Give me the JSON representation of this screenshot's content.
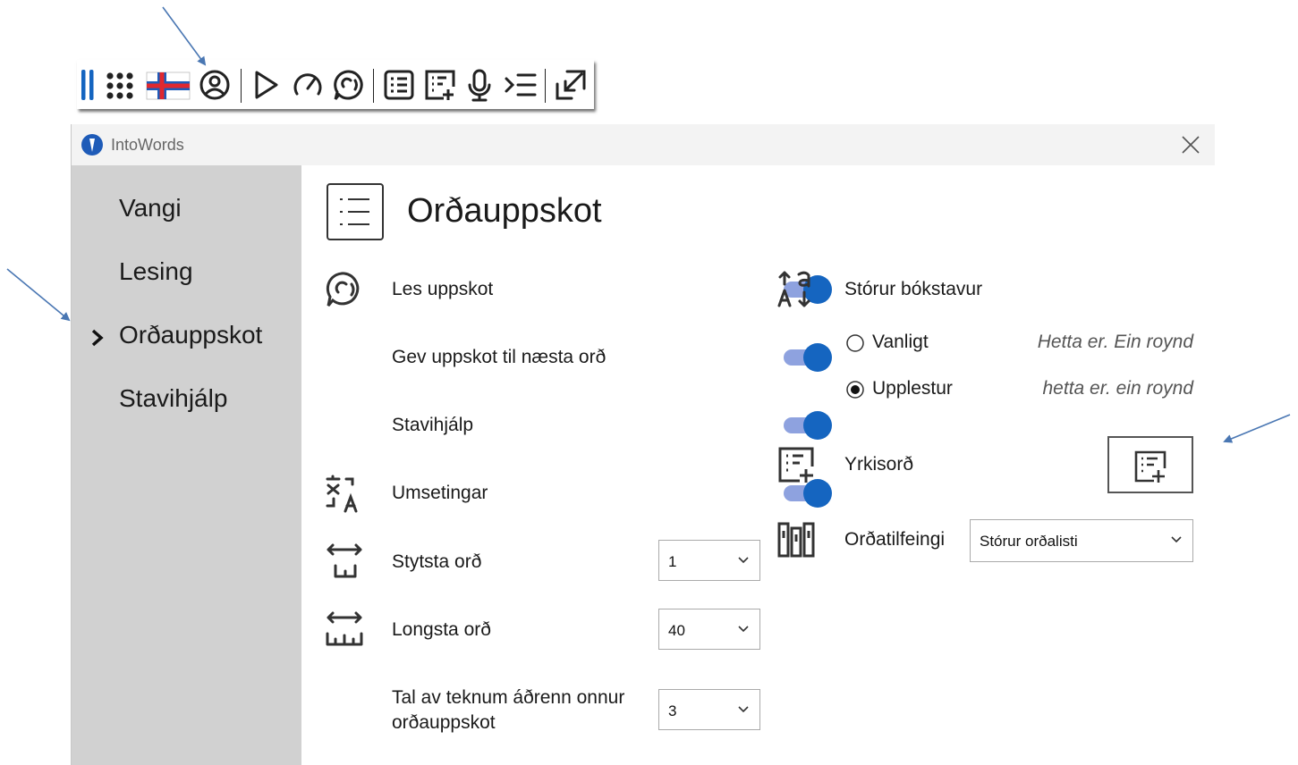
{
  "toolbar": {
    "buttons": [
      {
        "name": "drag-handle-icon"
      },
      {
        "name": "app-grid-icon"
      },
      {
        "name": "faroese-flag-icon"
      },
      {
        "name": "profile-icon"
      },
      {
        "name": "play-icon"
      },
      {
        "name": "speed-icon"
      },
      {
        "name": "read-suggestions-icon"
      },
      {
        "name": "word-list-icon"
      },
      {
        "name": "custom-words-icon"
      },
      {
        "name": "microphone-icon"
      },
      {
        "name": "text-indent-icon"
      },
      {
        "name": "minimize-icon"
      }
    ]
  },
  "window": {
    "title": "IntoWords",
    "close_icon": "close-icon"
  },
  "sidebar": {
    "items": [
      {
        "label": "Vangi",
        "active": false
      },
      {
        "label": "Lesing",
        "active": false
      },
      {
        "label": "Orðauppskot",
        "active": true
      },
      {
        "label": "Stavihjálp",
        "active": false
      }
    ]
  },
  "main": {
    "title": "Orðauppskot",
    "left": {
      "read_suggestions": {
        "label": "Les uppskot",
        "on": true
      },
      "next_word": {
        "label": "Gev uppskot til næsta orð",
        "on": true
      },
      "spell_help": {
        "label": "Stavihjálp",
        "on": true
      },
      "translations": {
        "label": "Umsetingar",
        "on": true
      },
      "shortest_word": {
        "label": "Stytsta orð",
        "value": "1"
      },
      "longest_word": {
        "label": "Longsta orð",
        "value": "40"
      },
      "chars_before": {
        "label_line1": "Tal av teknum áðrenn onnur",
        "label_line2": "orðauppskot",
        "value": "3"
      }
    },
    "right": {
      "capital_letter": {
        "label": "Stórur bókstavur",
        "options": [
          {
            "label": "Vanligt",
            "sample": "Hetta er. Ein roynd",
            "selected": false
          },
          {
            "label": "Upplestur",
            "sample": "hetta er. ein roynd",
            "selected": true
          }
        ]
      },
      "custom_words": {
        "label": "Yrkisorð"
      },
      "dictionary": {
        "label": "Orðatilfeingi",
        "value": "Stórur orðalisti"
      }
    }
  },
  "colors": {
    "toggle_track": "#8ea2df",
    "toggle_knob": "#1565c0",
    "sidebar_bg": "#d1d1d1",
    "titlebar_bg": "#f3f3f3",
    "annotation_arrow": "#4a77b3",
    "brand": "#1e5bb8"
  }
}
